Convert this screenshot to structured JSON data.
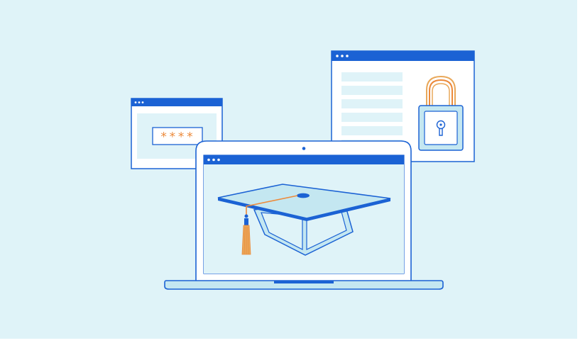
{
  "illustration": {
    "password_field": {
      "value": "****"
    },
    "colors": {
      "background": "#dff3f8",
      "page_margin": "#ffffff",
      "primary_blue": "#1b62d4",
      "light_blue": "#c4e7f1",
      "pale_blue": "#dff3f8",
      "white": "#ffffff",
      "orange": "#ec8a3b",
      "gold": "#e9a85a"
    },
    "icons": [
      "password-window-icon",
      "lock-window-icon",
      "laptop-icon",
      "graduation-cap-icon",
      "padlock-icon",
      "keyhole-icon"
    ]
  }
}
